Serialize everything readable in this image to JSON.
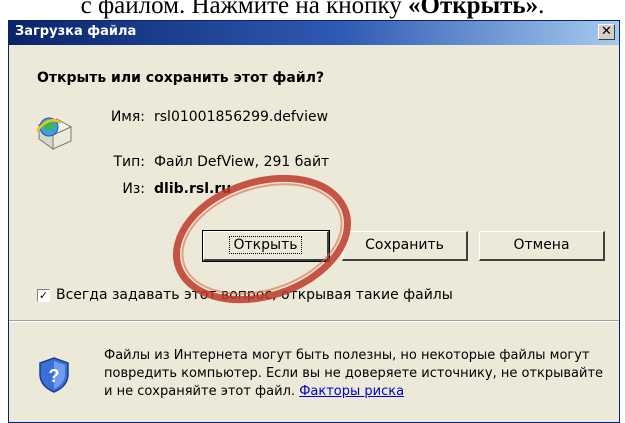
{
  "caption": {
    "prefix": "с файлом. Нажмите на кнопку ",
    "emphasis": "«Открыть»",
    "suffix": "."
  },
  "dialog": {
    "title": "Загрузка файла",
    "close_glyph": "✕",
    "question": "Открыть или сохранить этот файл?",
    "name_label": "Имя:",
    "name_value": "rsl01001856299.defview",
    "type_label": "Тип:",
    "type_value": "Файл DefView, 291 байт",
    "from_label": "Из:",
    "from_value": "dlib.rsl.ru",
    "buttons": {
      "open": "Открыть",
      "save": "Сохранить",
      "cancel": "Отмена"
    },
    "checkbox": {
      "checked": true,
      "glyph": "✓",
      "label": "Всегда задавать этот вопрос, открывая такие файлы"
    },
    "warning_text": "Файлы из Интернета могут быть полезны, но некоторые файлы могут повредить компьютер. Если вы не доверяете источнику, не открывайте и не сохраняйте этот файл.",
    "risk_link": "Факторы риска"
  },
  "icons": {
    "file": "ie-file-icon",
    "shield": "security-shield-icon"
  },
  "colors": {
    "title_bar": "#0a246a",
    "dialog_bg": "#ece9d8",
    "link": "#0000cc",
    "highlight_ring": "#c0392b"
  }
}
